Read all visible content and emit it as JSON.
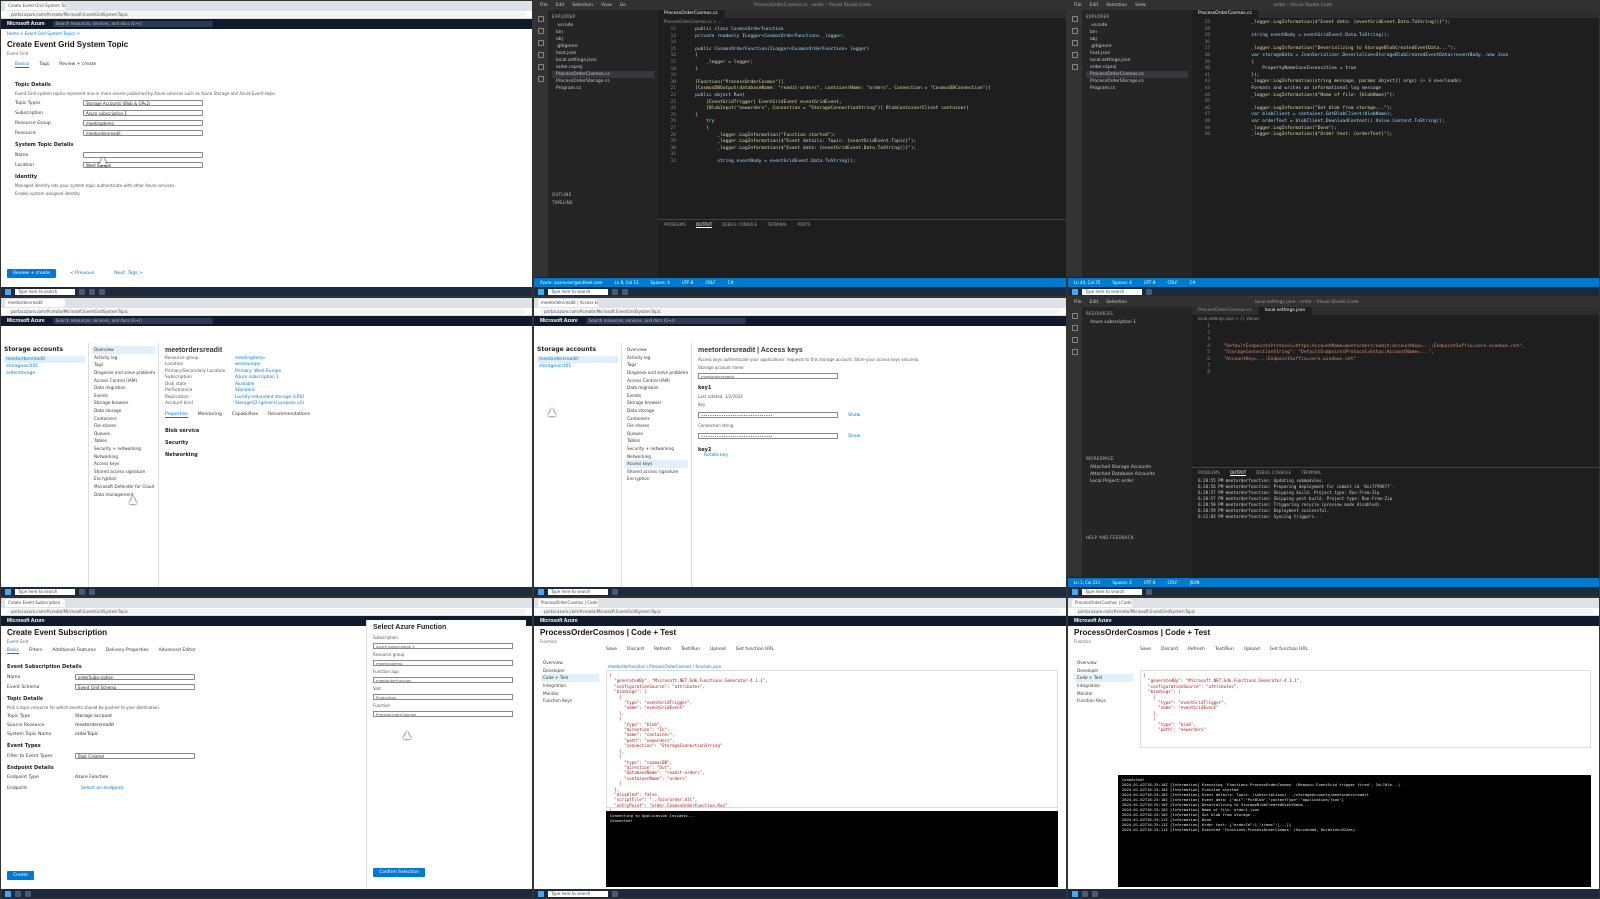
{
  "taskbar": {
    "search_placeholder": "Type here to search",
    "clock": "12:00"
  },
  "tile0": {
    "tab": "Create Event Grid System Topic",
    "address": "portal.azure.com/#create/Microsoft.EventGridSystemTopic",
    "brand": "Microsoft Azure",
    "search_placeholder": "Search resources, services, and docs (G+/)",
    "breadcrumb": "Home > Event Grid System Topics >",
    "title": "Create Event Grid System Topic",
    "subtitle": "Event Grid",
    "tabs": [
      "Basics",
      "Tags",
      "Review + create"
    ],
    "section_details": "Topic Details",
    "para1": "Event Grid system topics represent one or more events published by Azure services such as Azure Storage and Azure Event Hubs.",
    "fields": [
      {
        "label": "Topic Types",
        "value": "Storage Accounts (Blob & GPv2)"
      },
      {
        "label": "Subscription",
        "value": "Azure subscription 1"
      },
      {
        "label": "Resource Group",
        "value": "meetingdemo"
      },
      {
        "label": "Resource",
        "value": "meetordersreadit"
      }
    ],
    "section_system": "System Topic Details",
    "fields2": [
      {
        "label": "Name",
        "value": ""
      },
      {
        "label": "Location",
        "value": "West Europe"
      }
    ],
    "identity_h": "Identity",
    "identity_para": "Managed identity lets your system topic authenticate with other Azure services.",
    "identity_label": "Enable system assigned identity",
    "btn_review": "Review + create",
    "btn_prev": "< Previous",
    "btn_next": "Next: Tags >"
  },
  "tile1": {
    "menu": [
      "File",
      "Edit",
      "Selection",
      "View",
      "Go",
      "Run",
      "Terminal",
      "Help"
    ],
    "window_title": "ProcessOrderCosmos.cs - order - Visual Studio Code",
    "explorer_h": "EXPLORER",
    "files": [
      ".vscode",
      "bin",
      "obj",
      ".gitignore",
      "host.json",
      "local.settings.json",
      "order.csproj",
      "ProcessOrderCosmos.cs",
      "ProcessOrderStorage.cs",
      "Program.cs"
    ],
    "tab": "ProcessOrderCosmos.cs",
    "crumbs": "ProcessOrderCosmos.cs > ...",
    "panel_tabs": [
      "PROBLEMS",
      "OUTPUT",
      "DEBUG CONSOLE",
      "TERMINAL",
      "PORTS"
    ],
    "status": [
      "Azure: azureuser@outlook.com",
      "Ln 8, Col 13",
      "Spaces: 4",
      "UTF-8",
      "CRLF",
      "C#"
    ],
    "outline": "OUTLINE",
    "timeline": "TIMELINE",
    "lines": [
      {
        "n": "12",
        "t": "    public class CosmosOrderFunction"
      },
      {
        "n": "13",
        "t": "    private readonly ILogger<CosmosOrderFunction> _logger;"
      },
      {
        "n": "14",
        "t": ""
      },
      {
        "n": "15",
        "t": "    public CosmosOrderFunction(ILogger<CosmosOrderFunction> logger)"
      },
      {
        "n": "16",
        "t": "    {"
      },
      {
        "n": "17",
        "t": "        _logger = logger;"
      },
      {
        "n": "18",
        "t": "    }"
      },
      {
        "n": "19",
        "t": ""
      },
      {
        "n": "20",
        "t": "    [Function(\"ProcessOrderCosmos\")]"
      },
      {
        "n": "21",
        "t": "    [CosmosDBOutput(databaseName: \"readit-orders\", containerName: \"orders\", Connection = \"CosmosDBConnection\")]"
      },
      {
        "n": "22",
        "t": "    public object Run("
      },
      {
        "n": "23",
        "t": "        [EventGridTrigger] EventGridEvent eventGridEvent,"
      },
      {
        "n": "24",
        "t": "        [BlobInput(\"neworders\", Connection = \"StorageConnectionString\")] BlobContainerClient container)"
      },
      {
        "n": "25",
        "t": "    {"
      },
      {
        "n": "26",
        "t": "        try"
      },
      {
        "n": "27",
        "t": "        {"
      },
      {
        "n": "28",
        "t": "            _logger.LogInformation(\"Function started\");"
      },
      {
        "n": "29",
        "t": "            _logger.LogInformation($\"Event details: Topic: {eventGridEvent.Topic}\");"
      },
      {
        "n": "30",
        "t": "            _logger.LogInformation($\"Event data: {eventGridEvent.Data.ToString()}\");"
      },
      {
        "n": "31",
        "t": ""
      },
      {
        "n": "32",
        "t": "            string eventBody = eventGridEvent.Data.ToString();"
      }
    ]
  },
  "tile2": {
    "window_title": "order - Visual Studio Code",
    "tab": "ProcessOrderCosmos.cs",
    "lines": [
      {
        "n": "33",
        "t": "            _logger.LogInformation($\"Event data: {eventGridEvent.Data.ToString()}\");"
      },
      {
        "n": "34",
        "t": ""
      },
      {
        "n": "35",
        "t": "            string eventBody = eventGridEvent.Data.ToString();"
      },
      {
        "n": "36",
        "t": ""
      },
      {
        "n": "37",
        "t": "            _logger.LogInformation(\"Deserializing to StorageBlobCreatedEventData...\");"
      },
      {
        "n": "38",
        "t": "            var storageData = JsonSerializer.Deserialize<StorageBlobCreatedEventData>(eventBody, new Json"
      },
      {
        "n": "39",
        "t": "            {"
      },
      {
        "n": "40",
        "t": "                PropertyNameCaseInsensitive = true"
      },
      {
        "n": "41",
        "t": "            });"
      },
      {
        "n": "42",
        "t": "            _logger.LogInformation(string message, params object[] args) (+ 3 overloads)"
      },
      {
        "n": "43",
        "t": "            Formats and writes an informational log message"
      },
      {
        "n": "44",
        "t": "            _logger.LogInformation($\"Name of file: {blobName}\");"
      },
      {
        "n": "45",
        "t": ""
      },
      {
        "n": "46",
        "t": "            _logger.LogInformation(\"Got blob from storage...\");"
      },
      {
        "n": "47",
        "t": "            var blobClient = container.GetBlobClient(blobName);"
      },
      {
        "n": "48",
        "t": "            var orderText = blobClient.DownloadContent().Value.Content.ToString();"
      },
      {
        "n": "49",
        "t": "            _logger.LogInformation(\"Done\");"
      },
      {
        "n": "50",
        "t": "            _logger.LogInformation($\"Order text: {orderText}\");"
      }
    ],
    "status": [
      "Ln 44, Col 25",
      "Spaces: 4",
      "UTF-8",
      "CRLF",
      "C#"
    ]
  },
  "tile3": {
    "blade_title": "Storage accounts",
    "account": "meetordersreadit",
    "accounts": [
      "meetordersreadit",
      "storageacct01",
      "orderstorage"
    ],
    "menu": [
      "Overview",
      "Activity log",
      "Tags",
      "Diagnose and solve problems",
      "Access Control (IAM)",
      "Data migration",
      "Events",
      "Storage browser",
      "Data storage",
      "Containers",
      "File shares",
      "Queues",
      "Tables",
      "Security + networking",
      "Networking",
      "Access keys",
      "Shared access signature",
      "Encryption",
      "Microsoft Defender for Cloud",
      "Data management"
    ],
    "essentials": [
      {
        "k": "Resource group",
        "v": "meetingdemo"
      },
      {
        "k": "Location",
        "v": "westeurope"
      },
      {
        "k": "Primary/Secondary Location",
        "v": "Primary: West Europe"
      },
      {
        "k": "Subscription",
        "v": "Azure subscription 1"
      },
      {
        "k": "Disk state",
        "v": "Available"
      },
      {
        "k": "Performance",
        "v": "Standard"
      },
      {
        "k": "Replication",
        "v": "Locally-redundant storage (LRS)"
      },
      {
        "k": "Account kind",
        "v": "StorageV2 (general purpose v2)"
      }
    ],
    "props_tabs": [
      "Properties",
      "Monitoring",
      "Capabilities",
      "Recommendations",
      "Tutorials",
      "Tools + SDKs"
    ],
    "blob_h": "Blob service",
    "security_h": "Security",
    "networking_h": "Networking"
  },
  "tile4": {
    "blade_title": "Storage accounts",
    "account_title": "meetordersreadit | Access keys",
    "menu": [
      "Overview",
      "Activity log",
      "Tags",
      "Diagnose and solve problems",
      "Access Control (IAM)",
      "Data migration",
      "Events",
      "Storage browser",
      "Data storage",
      "Containers",
      "File shares",
      "Queues",
      "Tables",
      "Security + networking",
      "Networking",
      "Access keys",
      "Shared access signature",
      "Encryption"
    ],
    "info": "Access keys authenticate your applications' requests to this storage account. Store your access keys securely.",
    "account_name_label": "Storage account name",
    "account_name": "meetordersreadit",
    "key1": "key1",
    "key2": "key2",
    "rotate": "Rotate key",
    "last_rotated": "Last rotated: 1/2/2024",
    "key_label": "Key",
    "conn_label": "Connection string",
    "show": "Show",
    "masked": "••••••••••••••••••••••••••••••••"
  },
  "tile5": {
    "window_title": "local.settings.json - order - Visual Studio Code",
    "tabs": [
      "ProcessOrderCosmos.cs",
      "local.settings.json"
    ],
    "crumbs": "local.settings.json > {} Values",
    "side_h": "RESOURCES",
    "side_items": [
      "Azure subscription 1"
    ],
    "workspace_h": "WORKSPACE",
    "workspace_items": [
      "Attached Storage Accounts",
      "Attached Database Accounts",
      "Local Project: order"
    ],
    "help": "HELP AND FEEDBACK",
    "lines": [
      {
        "n": "1",
        "t": ""
      },
      {
        "n": "2",
        "t": ""
      },
      {
        "n": "3",
        "t": ""
      },
      {
        "n": "4",
        "t": "  \"DefaultEndpointsProtocol=https;AccountName=meetordersreadit;AccountKey=...;EndpointSuffix=core.windows.net\","
      },
      {
        "n": "5",
        "t": "  \"StorageConnectionString\": \"DefaultEndpointsProtocol=https;AccountName=...\","
      },
      {
        "n": "6",
        "t": "  \"AccountKey=...;EndpointSuffix=core.windows.net\""
      },
      {
        "n": "7",
        "t": ""
      },
      {
        "n": "8",
        "t": ""
      }
    ],
    "terminal": [
      "6:20:55 PM meetorderfunction: Updating submodules.",
      "6:20:56 PM meetorderfunction: Preparing deployment for commit id '0cc7f9967f'.",
      "6:20:57 PM meetorderfunction: Skipping build. Project type: Run-From-Zip",
      "6:20:57 PM meetorderfunction: Skipping post build. Project type: Run-From-Zip",
      "6:20:58 PM meetorderfunction: Triggering recycle (preview mode disabled).",
      "6:20:59 PM meetorderfunction: Deployment successful.",
      "6:21:03 PM meetorderfunction: Syncing triggers..."
    ],
    "status": [
      "Ln 1, Col 221",
      "Spaces: 2",
      "UTF-8",
      "CRLF",
      "JSON"
    ]
  },
  "tile6": {
    "title": "Create Event Subscription",
    "subtitle": "Event Grid",
    "tabs": [
      "Basic",
      "Filters",
      "Additional Features",
      "Delivery Properties",
      "Advanced Editor"
    ],
    "sub_details_h": "Event Subscription Details",
    "fields": [
      {
        "label": "Name",
        "value": "orderSubscription"
      },
      {
        "label": "Event Schema",
        "value": "Event Grid Schema"
      }
    ],
    "topic_h": "Topic Details",
    "topic_para": "Pick a topic resource for which events should be pushed to your destination.",
    "topic_fields": [
      {
        "label": "Topic Type",
        "value": "Storage account"
      },
      {
        "label": "Source Resource",
        "value": "meetordersreadit"
      },
      {
        "label": "System Topic Name",
        "value": "orderTopic"
      }
    ],
    "event_types_h": "Event Types",
    "filter_label": "Filter to Event Types",
    "filter_value": "Blob Created",
    "endpoint_h": "Endpoint Details",
    "endpoint_fields": [
      {
        "label": "Endpoint Type",
        "value": "Azure Function"
      },
      {
        "label": "Endpoint",
        "value": "Select an endpoint"
      }
    ],
    "create": "Create",
    "panel_title": "Select Azure Function",
    "panel_fields": [
      {
        "label": "Subscription",
        "value": "Azure subscription 1"
      },
      {
        "label": "Resource group",
        "value": "meetingdemo"
      },
      {
        "label": "Function app",
        "value": "meetorderfunction"
      },
      {
        "label": "Slot",
        "value": "Production"
      },
      {
        "label": "Function",
        "value": "ProcessOrderCosmos"
      }
    ],
    "confirm": "Confirm Selection"
  },
  "tile7": {
    "title": "ProcessOrderCosmos | Code + Test",
    "subtitle": "Function",
    "toolbar": [
      "Save",
      "Discard",
      "Refresh",
      "Test/Run",
      "Upload",
      "Get function URL"
    ],
    "path": "meetorderfunction \\ ProcessOrderCosmos \\ function.json",
    "menu": [
      "Overview",
      "Developer",
      "Code + Test",
      "Integration",
      "Monitor",
      "Function Keys"
    ],
    "json": [
      "{",
      "  \"generatedBy\": \"Microsoft.NET.Sdk.Functions.Generator-4.1.1\",",
      "  \"configurationSource\": \"attributes\",",
      "  \"bindings\": [",
      "    {",
      "      \"type\": \"eventGridTrigger\",",
      "      \"name\": \"eventGridEvent\"",
      "    },",
      "    {",
      "      \"type\": \"blob\",",
      "      \"direction\": \"In\",",
      "      \"name\": \"container\",",
      "      \"path\": \"neworders\",",
      "      \"connection\": \"StorageConnectionString\"",
      "    },",
      "    {",
      "      \"type\": \"cosmosDB\",",
      "      \"direction\": \"Out\",",
      "      \"databaseName\": \"readit-orders\",",
      "      \"containerName\": \"orders\"",
      "    }",
      "  ],",
      "  \"disabled\": false,",
      "  \"scriptFile\": \"../bin/order.dll\",",
      "  \"entryPoint\": \"order.CosmosOrderFunction.Run\"",
      "}"
    ],
    "log_header": "Connecting to Application Insights...",
    "log_lines": [
      "Connected!"
    ]
  },
  "tile8": {
    "title": "ProcessOrderCosmos | Code + Test",
    "subtitle": "Function",
    "toolbar": [
      "Save",
      "Discard",
      "Refresh",
      "Test/Run",
      "Upload",
      "Get function URL"
    ],
    "menu": [
      "Overview",
      "Developer",
      "Code + Test",
      "Integration",
      "Monitor",
      "Function Keys"
    ],
    "json": [
      "{",
      "  \"generatedBy\": \"Microsoft.NET.Sdk.Functions.Generator-4.1.1\",",
      "  \"configurationSource\": \"attributes\",",
      "  \"bindings\": [",
      "    {",
      "      \"type\": \"eventGridTrigger\",",
      "      \"name\": \"eventGridEvent\"",
      "    },",
      "    {",
      "      \"type\": \"blob\",",
      "      \"path\": \"neworders\""
    ],
    "log_lines": [
      "Connected!",
      "2024-01-02T18:25:10Z [Information] Executing 'Functions.ProcessOrderCosmos' (Reason='EventGrid trigger fired', Id=7d1a...)",
      "2024-01-02T18:25:10Z [Information] Function started",
      "2024-01-02T18:25:10Z [Information] Event details: Topic: /subscriptions/.../storageAccounts/meetordersreadit",
      "2024-01-02T18:25:10Z [Information] Event data: {\"api\":\"PutBlob\",\"contentType\":\"application/json\"}",
      "2024-01-02T18:25:10Z [Information] Deserializing to StorageBlobCreatedEventData...",
      "2024-01-02T18:25:10Z [Information] Name of file: order1.json",
      "2024-01-02T18:25:10Z [Information] Got blob from storage...",
      "2024-01-02T18:25:11Z [Information] Done",
      "2024-01-02T18:25:11Z [Information] Order text: {\"orderId\":1,\"items\":[...]}",
      "2024-01-02T18:25:11Z [Information] Executed 'Functions.ProcessOrderCosmos' (Succeeded, Duration=812ms)"
    ]
  }
}
